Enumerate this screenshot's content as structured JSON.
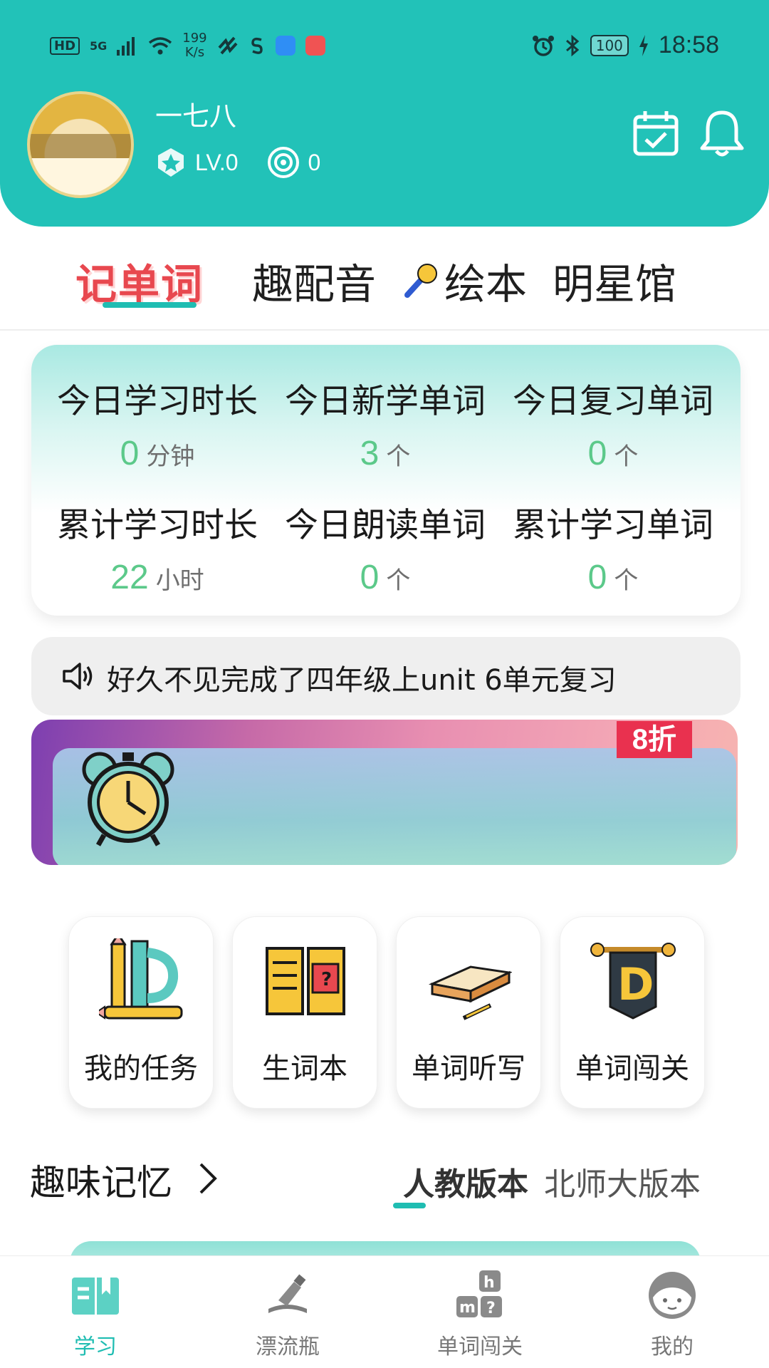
{
  "status_bar": {
    "network_hd": "HD",
    "network_gen": "5G",
    "speed_value": "199",
    "speed_unit": "K/s",
    "battery": "100",
    "time": "18:58"
  },
  "profile": {
    "name": "一七八",
    "level": "LV.0",
    "coins": "0"
  },
  "top_tabs": [
    "记单词",
    "趣配音",
    "绘本",
    "明星馆"
  ],
  "stats": [
    {
      "label": "今日学习时长",
      "value": "0",
      "unit": "分钟"
    },
    {
      "label": "今日新学单词",
      "value": "3",
      "unit": "个"
    },
    {
      "label": "今日复习单词",
      "value": "0",
      "unit": "个"
    },
    {
      "label": "累计学习时长",
      "value": "22",
      "unit": "小时"
    },
    {
      "label": "今日朗读单词",
      "value": "0",
      "unit": "个"
    },
    {
      "label": "累计学习单词",
      "value": "0",
      "unit": "个"
    }
  ],
  "notice": "好久不见完成了四年级上unit 6单元复习",
  "banner": {
    "badge": "8折"
  },
  "features": [
    {
      "label": "我的任务",
      "icon": "ruler-pencil-icon"
    },
    {
      "label": "生词本",
      "icon": "open-book-icon"
    },
    {
      "label": "单词听写",
      "icon": "book-pen-icon"
    },
    {
      "label": "单词闯关",
      "icon": "d-banner-icon"
    }
  ],
  "fun_memory": {
    "title": "趣味记忆",
    "editions": [
      "人教版本",
      "北师大版本"
    ],
    "active_edition": "人教版本"
  },
  "bottom_nav": [
    {
      "label": "学习",
      "icon": "book-icon",
      "active": true
    },
    {
      "label": "漂流瓶",
      "icon": "bottle-icon",
      "active": false
    },
    {
      "label": "单词闯关",
      "icon": "letter-blocks-icon",
      "active": false
    },
    {
      "label": "我的",
      "icon": "face-icon",
      "active": false
    }
  ],
  "colors": {
    "primary": "#22c2b8",
    "accent_red": "#e8484f",
    "stat_green": "#5cc98a",
    "badge_red": "#e9314f"
  }
}
